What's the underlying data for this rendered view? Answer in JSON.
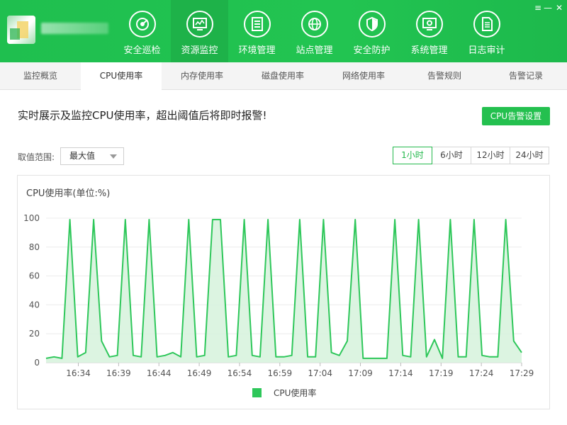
{
  "nav": {
    "items": [
      {
        "label": "安全巡检",
        "icon": "radar-icon",
        "active": false
      },
      {
        "label": "资源监控",
        "icon": "monitor-chart-icon",
        "active": true
      },
      {
        "label": "环境管理",
        "icon": "server-icon",
        "active": false
      },
      {
        "label": "站点管理",
        "icon": "globe-icon",
        "active": false
      },
      {
        "label": "安全防护",
        "icon": "shield-icon",
        "active": false
      },
      {
        "label": "系统管理",
        "icon": "settings-monitor-icon",
        "active": false
      },
      {
        "label": "日志审计",
        "icon": "document-icon",
        "active": false
      }
    ],
    "window_controls": {
      "menu": "≡",
      "minimize": "—",
      "close": "✕"
    }
  },
  "subtabs": [
    {
      "label": "监控概览",
      "active": false
    },
    {
      "label": "CPU使用率",
      "active": true
    },
    {
      "label": "内存使用率",
      "active": false
    },
    {
      "label": "磁盘使用率",
      "active": false
    },
    {
      "label": "网络使用率",
      "active": false
    },
    {
      "label": "告警规则",
      "active": false
    },
    {
      "label": "告警记录",
      "active": false
    }
  ],
  "content": {
    "headline": "实时展示及监控CPU使用率，超出阈值后将即时报警!",
    "alert_button": "CPU告警设置",
    "range_label": "取值范围:",
    "range_value": "最大值",
    "time_ranges": [
      {
        "label": "1小时",
        "active": true
      },
      {
        "label": "6小时",
        "active": false
      },
      {
        "label": "12小时",
        "active": false
      },
      {
        "label": "24小时",
        "active": false
      }
    ]
  },
  "colors": {
    "brand": "#22c451",
    "accent": "#24c04f",
    "series_line": "#2ec75a",
    "series_fill": "#d8f3de"
  },
  "chart_data": {
    "type": "area",
    "title": "CPU使用率(单位:%)",
    "xlabel": "",
    "ylabel": "",
    "ylim": [
      0,
      100
    ],
    "yticks": [
      0,
      20,
      40,
      60,
      80,
      100
    ],
    "xlim": [
      "16:30",
      "17:29"
    ],
    "xticks": [
      "16:34",
      "16:39",
      "16:44",
      "16:49",
      "16:54",
      "16:59",
      "17:04",
      "17:09",
      "17:14",
      "17:19",
      "17:24",
      "17:29"
    ],
    "grid": true,
    "legend_position": "bottom-center",
    "series": [
      {
        "name": "CPU使用率",
        "color": "#2ec75a",
        "points": [
          [
            "16:30",
            3
          ],
          [
            "16:31",
            4
          ],
          [
            "16:32",
            3
          ],
          [
            "16:33",
            99
          ],
          [
            "16:34",
            4
          ],
          [
            "16:35",
            7
          ],
          [
            "16:36",
            99
          ],
          [
            "16:37",
            15
          ],
          [
            "16:38",
            4
          ],
          [
            "16:39",
            5
          ],
          [
            "16:40",
            99
          ],
          [
            "16:41",
            5
          ],
          [
            "16:42",
            4
          ],
          [
            "16:43",
            99
          ],
          [
            "16:44",
            4
          ],
          [
            "16:45",
            5
          ],
          [
            "16:46",
            7
          ],
          [
            "16:47",
            4
          ],
          [
            "16:48",
            99
          ],
          [
            "16:49",
            4
          ],
          [
            "16:50",
            5
          ],
          [
            "16:51",
            99
          ],
          [
            "16:52",
            99
          ],
          [
            "16:53",
            4
          ],
          [
            "16:54",
            5
          ],
          [
            "16:55",
            99
          ],
          [
            "16:56",
            5
          ],
          [
            "16:57",
            4
          ],
          [
            "16:58",
            99
          ],
          [
            "16:59",
            4
          ],
          [
            "17:00",
            4
          ],
          [
            "17:01",
            5
          ],
          [
            "17:02",
            99
          ],
          [
            "17:03",
            4
          ],
          [
            "17:04",
            4
          ],
          [
            "17:05",
            99
          ],
          [
            "17:06",
            7
          ],
          [
            "17:07",
            5
          ],
          [
            "17:08",
            15
          ],
          [
            "17:09",
            99
          ],
          [
            "17:10",
            3
          ],
          [
            "17:11",
            3
          ],
          [
            "17:12",
            3
          ],
          [
            "17:13",
            3
          ],
          [
            "17:14",
            99
          ],
          [
            "17:15",
            5
          ],
          [
            "17:16",
            4
          ],
          [
            "17:17",
            99
          ],
          [
            "17:18",
            4
          ],
          [
            "17:19",
            16
          ],
          [
            "17:20",
            3
          ],
          [
            "17:21",
            99
          ],
          [
            "17:22",
            4
          ],
          [
            "17:23",
            4
          ],
          [
            "17:24",
            99
          ],
          [
            "17:25",
            5
          ],
          [
            "17:26",
            4
          ],
          [
            "17:27",
            4
          ],
          [
            "17:28",
            99
          ],
          [
            "17:29",
            15
          ],
          [
            "17:29",
            7
          ]
        ]
      }
    ]
  }
}
